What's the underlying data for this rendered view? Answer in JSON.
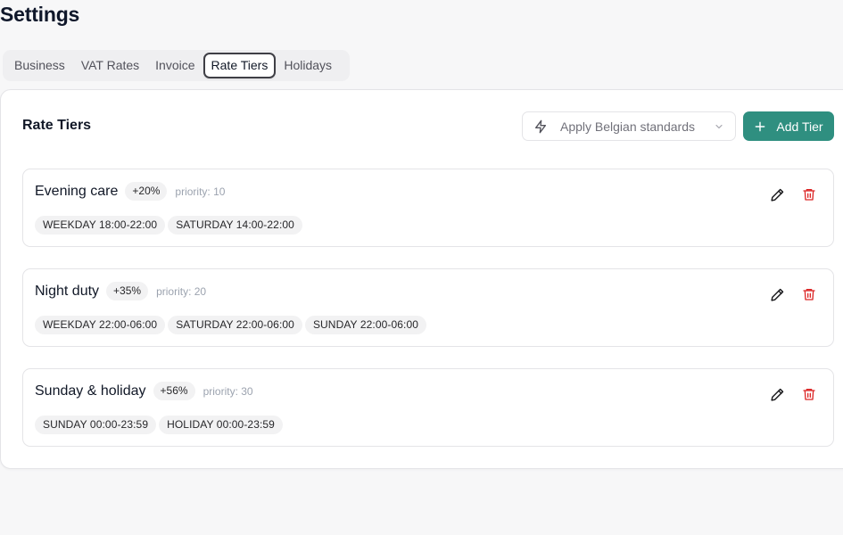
{
  "page": {
    "title": "Settings"
  },
  "tabs": [
    {
      "label": "Business",
      "active": false
    },
    {
      "label": "VAT Rates",
      "active": false
    },
    {
      "label": "Invoice",
      "active": false
    },
    {
      "label": "Rate Tiers",
      "active": true
    },
    {
      "label": "Holidays",
      "active": false
    }
  ],
  "panel": {
    "title": "Rate Tiers",
    "standards_label": "Apply Belgian standards",
    "add_label": "Add Tier"
  },
  "tiers": [
    {
      "name": "Evening care",
      "surcharge": "+20%",
      "priority": "priority: 10",
      "windows": [
        "WEEKDAY 18:00-22:00",
        "SATURDAY 14:00-22:00"
      ]
    },
    {
      "name": "Night duty",
      "surcharge": "+35%",
      "priority": "priority: 20",
      "windows": [
        "WEEKDAY 22:00-06:00",
        "SATURDAY 22:00-06:00",
        "SUNDAY 22:00-06:00"
      ]
    },
    {
      "name": "Sunday & holiday",
      "surcharge": "+56%",
      "priority": "priority: 30",
      "windows": [
        "SUNDAY 00:00-23:59",
        "HOLIDAY 00:00-23:59"
      ]
    }
  ],
  "icons": {
    "standards": "bolt-icon",
    "dropdown": "chevron-down-icon",
    "add": "plus-icon",
    "edit": "pencil-icon",
    "delete": "trash-icon"
  },
  "colors": {
    "accent": "#2f8f80",
    "danger": "#dc2626",
    "chip_bg": "#f2f2f3"
  }
}
